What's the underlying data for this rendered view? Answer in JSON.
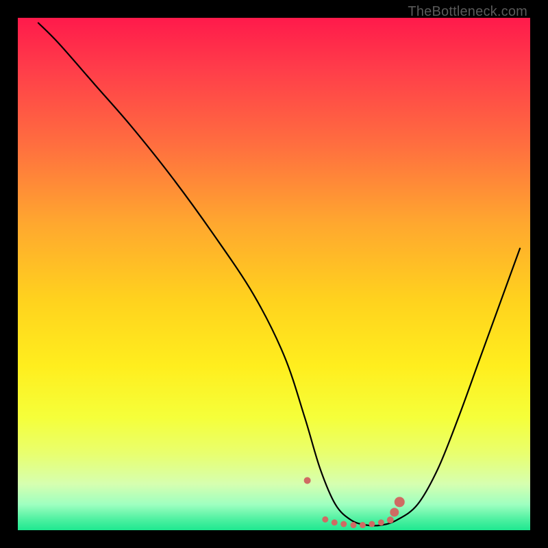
{
  "watermark": "TheBottleneck.com",
  "chart_data": {
    "type": "line",
    "title": "",
    "xlabel": "",
    "ylabel": "",
    "xlim": [
      0,
      100
    ],
    "ylim": [
      0,
      100
    ],
    "series": [
      {
        "name": "curve",
        "x": [
          4,
          8,
          15,
          22,
          30,
          38,
          46,
          52,
          56,
          59,
          62,
          65,
          68,
          71,
          74,
          78,
          82,
          86,
          90,
          94,
          98
        ],
        "y": [
          99,
          95,
          87,
          79,
          69,
          58,
          46,
          34,
          22,
          12,
          5,
          2,
          1,
          1,
          2,
          5,
          12,
          22,
          33,
          44,
          55
        ]
      }
    ],
    "markers": {
      "name": "highlight-points",
      "color": "#cf6b63",
      "x": [
        56.5,
        60.0,
        61.8,
        63.6,
        65.5,
        67.3,
        69.1,
        70.9,
        72.7,
        73.5,
        74.5
      ],
      "y": [
        9.7,
        2.1,
        1.5,
        1.2,
        1.0,
        1.0,
        1.2,
        1.5,
        2.0,
        3.5,
        5.5
      ],
      "r": [
        5.0,
        4.5,
        4.5,
        4.5,
        4.5,
        4.5,
        4.5,
        4.5,
        5.0,
        6.5,
        7.5
      ]
    }
  }
}
